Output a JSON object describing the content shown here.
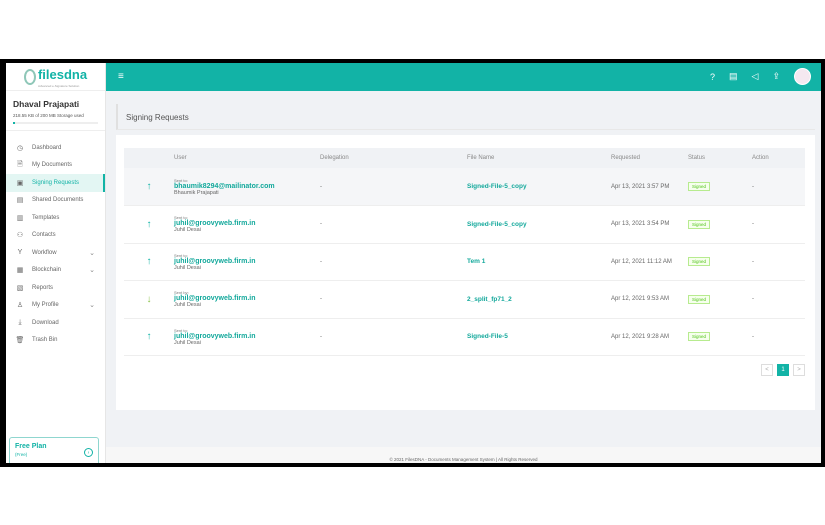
{
  "brand": {
    "name": "filesdna",
    "tagline": "Advanced e-Signature Solution"
  },
  "user": {
    "name": "Dhaval Prajapati",
    "storage": "218.55 KB of 200 MB Storage used",
    "storage_fraction": 0.001
  },
  "nav": [
    {
      "label": "Dashboard",
      "icon": "◷"
    },
    {
      "label": "My Documents",
      "icon": "🗎"
    },
    {
      "label": "Signing Requests",
      "icon": "▣",
      "active": true
    },
    {
      "label": "Shared Documents",
      "icon": "▤"
    },
    {
      "label": "Templates",
      "icon": "▥"
    },
    {
      "label": "Contacts",
      "icon": "⚇"
    },
    {
      "label": "Workflow",
      "icon": "Y",
      "chev": "⌄"
    },
    {
      "label": "Blockchain",
      "icon": "▦",
      "chev": "⌄"
    },
    {
      "label": "Reports",
      "icon": "▧"
    },
    {
      "label": "My Profile",
      "icon": "♙",
      "chev": "⌄"
    },
    {
      "label": "Download",
      "icon": "⤓"
    },
    {
      "label": "Trash Bin",
      "icon": "🗑"
    }
  ],
  "plan": {
    "title": "Free Plan",
    "sub": "(Free)"
  },
  "page_title": "Signing Requests",
  "columns": [
    "",
    "User",
    "Delegation",
    "File Name",
    "Requested",
    "Status",
    "Action"
  ],
  "rows": [
    {
      "dir": "up",
      "arrow": "↑",
      "label": "Sent to:",
      "email": "bhaumik8294@mailinator.com",
      "name": "Bhaumik Prajapati",
      "delegation": "-",
      "file": "Signed-File-5_copy",
      "requested": "Apr 13, 2021 3:57 PM",
      "status": "Signed",
      "action": "-"
    },
    {
      "dir": "up",
      "arrow": "↑",
      "label": "Sent to:",
      "email": "juhil@groovyweb.firm.in",
      "name": "Juhil Desai",
      "delegation": "-",
      "file": "Signed-File-5_copy",
      "requested": "Apr 13, 2021 3:54 PM",
      "status": "Signed",
      "action": "-"
    },
    {
      "dir": "up",
      "arrow": "↑",
      "label": "Sent to:",
      "email": "juhil@groovyweb.firm.in",
      "name": "Juhil Desai",
      "delegation": "-",
      "file": "Tem 1",
      "requested": "Apr 12, 2021 11:12 AM",
      "status": "Signed",
      "action": "-"
    },
    {
      "dir": "down",
      "arrow": "↓",
      "label": "Sent by:",
      "email": "juhil@groovyweb.firm.in",
      "name": "Juhil Desai",
      "delegation": "-",
      "file": "2_split_fp71_2",
      "requested": "Apr 12, 2021 9:53 AM",
      "status": "Signed",
      "action": "-"
    },
    {
      "dir": "up",
      "arrow": "↑",
      "label": "Sent to:",
      "email": "juhil@groovyweb.firm.in",
      "name": "Juhil Desai",
      "delegation": "-",
      "file": "Signed-File-5",
      "requested": "Apr 12, 2021 9:28 AM",
      "status": "Signed",
      "action": "-"
    }
  ],
  "pager": {
    "prev": "<",
    "page": "1",
    "next": ">"
  },
  "footer": "© 2021 FilesDNA - Documents Management System | All Rights Reserved"
}
